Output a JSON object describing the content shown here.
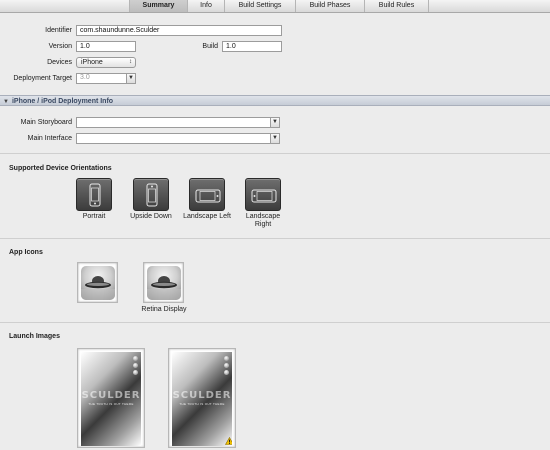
{
  "tabs": [
    {
      "label": "Summary",
      "active": true
    },
    {
      "label": "Info",
      "active": false
    },
    {
      "label": "Build Settings",
      "active": false
    },
    {
      "label": "Build Phases",
      "active": false
    },
    {
      "label": "Build Rules",
      "active": false
    }
  ],
  "target": {
    "identifier_label": "Identifier",
    "identifier_value": "com.shaundunne.Sculder",
    "version_label": "Version",
    "version_value": "1.0",
    "build_label": "Build",
    "build_value": "1.0",
    "devices_label": "Devices",
    "devices_value": "iPhone",
    "deployment_label": "Deployment Target",
    "deployment_value": "3.0"
  },
  "deployment_info": {
    "section_title": "iPhone / iPod Deployment Info",
    "storyboard_label": "Main Storyboard",
    "storyboard_value": "",
    "interface_label": "Main Interface",
    "interface_value": ""
  },
  "orientations": {
    "heading": "Supported Device Orientations",
    "items": [
      {
        "label": "Portrait",
        "icon": "portrait-icon",
        "selected": true
      },
      {
        "label": "Upside Down",
        "icon": "upside-down-icon",
        "selected": true
      },
      {
        "label": "Landscape Left",
        "icon": "landscape-left-icon",
        "selected": true
      },
      {
        "label": "Landscape Right",
        "icon": "landscape-right-icon",
        "selected": true
      }
    ]
  },
  "app_icons": {
    "heading": "App Icons",
    "retina_label": "Retina Display"
  },
  "launch_images": {
    "heading": "Launch Images",
    "logo_text": "SCULDER",
    "tagline": "THE TRUTH IS OUT THERE"
  }
}
